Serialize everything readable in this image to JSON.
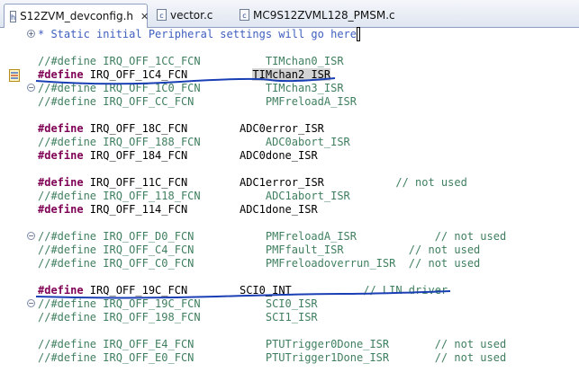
{
  "tabs": [
    {
      "label": "S12ZVM_devconfig.h",
      "icon": "header-file-icon",
      "icon_glyph": "h",
      "active": true
    },
    {
      "label": "vector.c",
      "icon": "c-file-icon",
      "icon_glyph": "c",
      "active": false
    },
    {
      "label": "MC9S12ZVML128_PMSM.c",
      "icon": "c-file-icon",
      "icon_glyph": "c",
      "active": false
    }
  ],
  "close_glyph": "✕",
  "editor": {
    "line1_text": "* Static initial Peripheral settings will go here",
    "lines": [
      {
        "c": "//#define IRQ_OFF_1CC_FCN          TIMchan0_ISR"
      },
      {
        "k": "#define",
        "m": " IRQ_OFF_1C4_FCN          ",
        "h": "TIMchan2_ISR"
      },
      {
        "c": "//#define IRQ_OFF_1C0_FCN          TIMchan3_ISR"
      },
      {
        "c": "//#define IRQ_OFF_CC_FCN           PMFreloadA_ISR"
      },
      {},
      {
        "k": "#define",
        "m": " IRQ_OFF_18C_FCN        ADC0error_ISR"
      },
      {
        "c": "//#define IRQ_OFF_188_FCN          ADC0abort_ISR"
      },
      {
        "k": "#define",
        "m": " IRQ_OFF_184_FCN        ADC0done_ISR"
      },
      {},
      {
        "k": "#define",
        "m": " IRQ_OFF_11C_FCN        ADC1error_ISR",
        "t": "           // not used"
      },
      {
        "c": "//#define IRQ_OFF_118_FCN          ADC1abort_ISR"
      },
      {
        "k": "#define",
        "m": " IRQ_OFF_114_FCN        ADC1done_ISR"
      },
      {},
      {
        "c": "//#define IRQ_OFF_D0_FCN           PMFreloadA_ISR            // not used"
      },
      {
        "c": "//#define IRQ_OFF_C4_FCN           PMFfault_ISR          // not used"
      },
      {
        "c": "//#define IRQ_OFF_C0_FCN           PMFreloadoverrun_ISR  // not used"
      },
      {},
      {
        "k": "#define",
        "m": " IRQ_OFF_19C_FCN        SCI0_INT",
        "t": "           // LIN driver"
      },
      {
        "c": "//#define IRQ_OFF_19C_FCN          SCI0_ISR"
      },
      {
        "c": "//#define IRQ_OFF_198_FCN          SCI1_ISR"
      },
      {},
      {
        "c": "//#define IRQ_OFF_E4_FCN           PTUTrigger0Done_ISR       // not used"
      },
      {
        "c": "//#define IRQ_OFF_E0_FCN           PTUTrigger1Done_ISR       // not used"
      }
    ]
  },
  "colors": {
    "keyword": "#7f0055",
    "comment": "#3f7f5f",
    "doc_comment": "#3f5fbf",
    "ink": "#1a3fb5"
  }
}
